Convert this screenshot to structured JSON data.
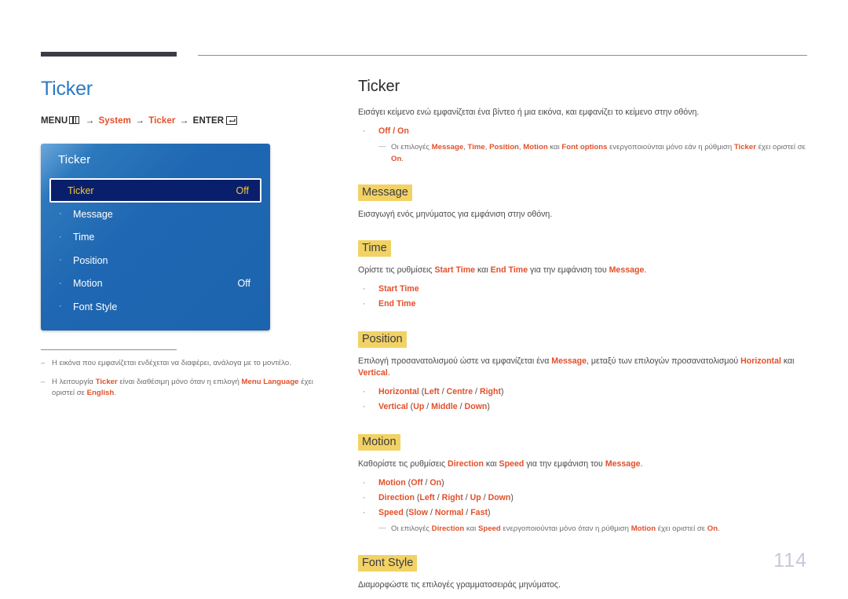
{
  "left": {
    "title": "Ticker",
    "menu_path": {
      "menu_label": "MENU",
      "menu_icon": "menu-grid-icon",
      "arrow": "→",
      "step1": "System",
      "step2": "Ticker",
      "enter_label": "ENTER",
      "enter_icon": "enter-key-icon"
    },
    "osd": {
      "title": "Ticker",
      "rows": [
        {
          "label": "Ticker",
          "value": "Off",
          "selected": true,
          "bullet": ""
        },
        {
          "label": "Message",
          "value": "",
          "selected": false,
          "bullet": "·"
        },
        {
          "label": "Time",
          "value": "",
          "selected": false,
          "bullet": "·"
        },
        {
          "label": "Position",
          "value": "",
          "selected": false,
          "bullet": "·"
        },
        {
          "label": "Motion",
          "value": "Off",
          "selected": false,
          "bullet": "·"
        },
        {
          "label": "Font Style",
          "value": "",
          "selected": false,
          "bullet": "·"
        }
      ]
    },
    "footnotes": [
      {
        "dash": "–",
        "parts": [
          {
            "t": "Η εικόνα που εμφανίζεται ενδέχεται να διαφέρει, ανάλογα με το μοντέλο.",
            "b": false
          }
        ]
      },
      {
        "dash": "–",
        "parts": [
          {
            "t": "Η λειτουργία ",
            "b": false
          },
          {
            "t": "Ticker",
            "b": true
          },
          {
            "t": " είναι διαθέσιμη μόνο όταν η επιλογή ",
            "b": false
          },
          {
            "t": "Menu Language",
            "b": true
          },
          {
            "t": " έχει οριστεί σε ",
            "b": false
          },
          {
            "t": "English",
            "b": true
          },
          {
            "t": ".",
            "b": false
          }
        ]
      }
    ]
  },
  "right": {
    "title": "Ticker",
    "intro": "Εισάγει κείμενο ενώ εμφανίζεται ένα βίντεο ή μια εικόνα, και εμφανίζει το κείμενο στην οθόνη.",
    "intro_bullet": {
      "bullet": "·",
      "parts": [
        {
          "t": "Off",
          "b": true
        },
        {
          "t": " / ",
          "b": false
        },
        {
          "t": "On",
          "b": true
        }
      ]
    },
    "intro_subnote": {
      "dash": "—",
      "parts": [
        {
          "t": "Οι επιλογές ",
          "b": false
        },
        {
          "t": "Message",
          "b": true
        },
        {
          "t": ", ",
          "b": false
        },
        {
          "t": "Time",
          "b": true
        },
        {
          "t": ", ",
          "b": false
        },
        {
          "t": "Position",
          "b": true
        },
        {
          "t": ", ",
          "b": false
        },
        {
          "t": "Motion",
          "b": true
        },
        {
          "t": " και ",
          "b": false
        },
        {
          "t": "Font options",
          "b": true
        },
        {
          "t": " ενεργοποιούνται μόνο εάν η ρύθμιση ",
          "b": false
        },
        {
          "t": "Ticker",
          "b": true
        },
        {
          "t": " έχει οριστεί σε ",
          "b": false
        },
        {
          "t": "On",
          "b": true
        },
        {
          "t": ".",
          "b": false
        }
      ]
    },
    "sections": [
      {
        "heading": "Message",
        "body": [
          {
            "t": "Εισαγωγή ενός μηνύματος για εμφάνιση στην οθόνη.",
            "b": false
          }
        ],
        "bullets": [],
        "subnote": null
      },
      {
        "heading": "Time",
        "body": [
          {
            "t": "Ορίστε τις ρυθμίσεις ",
            "b": false
          },
          {
            "t": "Start Time",
            "b": true
          },
          {
            "t": " και ",
            "b": false
          },
          {
            "t": "End Time",
            "b": true
          },
          {
            "t": " για την εμφάνιση του ",
            "b": false
          },
          {
            "t": "Message",
            "b": true
          },
          {
            "t": ".",
            "b": false
          }
        ],
        "bullets": [
          {
            "bullet": "·",
            "parts": [
              {
                "t": "Start Time",
                "b": true
              }
            ]
          },
          {
            "bullet": "·",
            "parts": [
              {
                "t": "End Time",
                "b": true
              }
            ]
          }
        ],
        "subnote": null
      },
      {
        "heading": "Position",
        "body": [
          {
            "t": "Επιλογή προσανατολισμού ώστε να εμφανίζεται ένα ",
            "b": false
          },
          {
            "t": "Message",
            "b": true
          },
          {
            "t": ", μεταξύ των επιλογών προσανατολισμού ",
            "b": false
          },
          {
            "t": "Horizontal",
            "b": true
          },
          {
            "t": " και ",
            "b": false
          },
          {
            "t": "Vertical",
            "b": true
          },
          {
            "t": ".",
            "b": false
          }
        ],
        "bullets": [
          {
            "bullet": "·",
            "parts": [
              {
                "t": "Horizontal",
                "b": true
              },
              {
                "t": " (",
                "b": false,
                "plain": true
              },
              {
                "t": "Left",
                "b": true
              },
              {
                "t": " / ",
                "b": false,
                "plain": true
              },
              {
                "t": "Centre",
                "b": true
              },
              {
                "t": " / ",
                "b": false,
                "plain": true
              },
              {
                "t": "Right",
                "b": true
              },
              {
                "t": ")",
                "b": false,
                "plain": true
              }
            ]
          },
          {
            "bullet": "·",
            "parts": [
              {
                "t": "Vertical",
                "b": true
              },
              {
                "t": " (",
                "b": false,
                "plain": true
              },
              {
                "t": "Up",
                "b": true
              },
              {
                "t": " / ",
                "b": false,
                "plain": true
              },
              {
                "t": "Middle",
                "b": true
              },
              {
                "t": " / ",
                "b": false,
                "plain": true
              },
              {
                "t": "Down",
                "b": true
              },
              {
                "t": ")",
                "b": false,
                "plain": true
              }
            ]
          }
        ],
        "subnote": null
      },
      {
        "heading": "Motion",
        "body": [
          {
            "t": "Καθορίστε τις ρυθμίσεις ",
            "b": false
          },
          {
            "t": "Direction",
            "b": true
          },
          {
            "t": " και ",
            "b": false
          },
          {
            "t": "Speed",
            "b": true
          },
          {
            "t": " για την εμφάνιση του ",
            "b": false
          },
          {
            "t": "Message",
            "b": true
          },
          {
            "t": ".",
            "b": false
          }
        ],
        "bullets": [
          {
            "bullet": "·",
            "parts": [
              {
                "t": "Motion",
                "b": true
              },
              {
                "t": " (",
                "b": false,
                "plain": true
              },
              {
                "t": "Off",
                "b": true
              },
              {
                "t": " / ",
                "b": false,
                "plain": true
              },
              {
                "t": "On",
                "b": true
              },
              {
                "t": ")",
                "b": false,
                "plain": true
              }
            ]
          },
          {
            "bullet": "·",
            "parts": [
              {
                "t": "Direction",
                "b": true
              },
              {
                "t": " (",
                "b": false,
                "plain": true
              },
              {
                "t": "Left",
                "b": true
              },
              {
                "t": " / ",
                "b": false,
                "plain": true
              },
              {
                "t": "Right",
                "b": true
              },
              {
                "t": " / ",
                "b": false,
                "plain": true
              },
              {
                "t": "Up",
                "b": true
              },
              {
                "t": " / ",
                "b": false,
                "plain": true
              },
              {
                "t": "Down",
                "b": true
              },
              {
                "t": ")",
                "b": false,
                "plain": true
              }
            ]
          },
          {
            "bullet": "·",
            "parts": [
              {
                "t": "Speed",
                "b": true
              },
              {
                "t": " (",
                "b": false,
                "plain": true
              },
              {
                "t": "Slow",
                "b": true
              },
              {
                "t": " / ",
                "b": false,
                "plain": true
              },
              {
                "t": "Normal",
                "b": true
              },
              {
                "t": " / ",
                "b": false,
                "plain": true
              },
              {
                "t": "Fast",
                "b": true
              },
              {
                "t": ")",
                "b": false,
                "plain": true
              }
            ]
          }
        ],
        "subnote": {
          "dash": "—",
          "parts": [
            {
              "t": "Οι επιλογές ",
              "b": false
            },
            {
              "t": "Direction",
              "b": true
            },
            {
              "t": " και ",
              "b": false
            },
            {
              "t": "Speed",
              "b": true
            },
            {
              "t": " ενεργοποιούνται μόνο όταν η ρύθμιση ",
              "b": false
            },
            {
              "t": "Motion",
              "b": true
            },
            {
              "t": " έχει οριστεί σε ",
              "b": false
            },
            {
              "t": "On",
              "b": true
            },
            {
              "t": ".",
              "b": false
            }
          ]
        }
      },
      {
        "heading": "Font Style",
        "body": [
          {
            "t": "Διαμορφώστε τις επιλογές γραμματοσειράς μηνύματος.",
            "b": false
          }
        ],
        "bullets": [],
        "subnote": null
      }
    ]
  },
  "page_number": "114",
  "colors": {
    "accent_orange": "#e2502a",
    "title_blue": "#2b7ac2",
    "osd_blue": "#1d64ae",
    "osd_selected_bg": "#0a1f6b",
    "osd_selected_text": "#f4c637",
    "highlight_yellow": "#f2d264",
    "rule_gray": "#8d8d95",
    "page_number_gray": "#c8c8d8"
  }
}
